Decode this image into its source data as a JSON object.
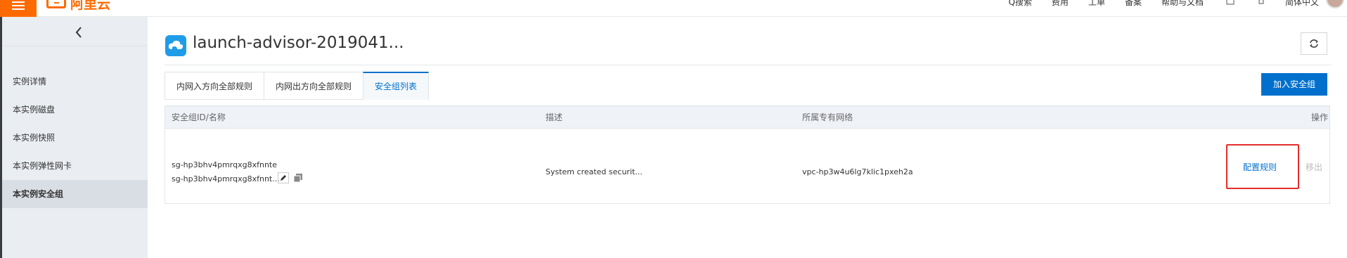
{
  "topbar": {
    "brand": "阿里云",
    "nav": [
      "Q搜索",
      "费用",
      "工单",
      "备案",
      "帮助与文档"
    ],
    "language": "简体中文"
  },
  "sidebar": {
    "items": [
      {
        "label": "实例详情",
        "active": false
      },
      {
        "label": "本实例磁盘",
        "active": false
      },
      {
        "label": "本实例快照",
        "active": false
      },
      {
        "label": "本实例弹性网卡",
        "active": false
      },
      {
        "label": "本实例安全组",
        "active": true
      }
    ]
  },
  "page": {
    "title": "launch-advisor-2019041..."
  },
  "tabs": [
    {
      "label": "内网入方向全部规则",
      "active": false
    },
    {
      "label": "内网出方向全部规则",
      "active": false
    },
    {
      "label": "安全组列表",
      "active": true
    }
  ],
  "actions": {
    "add_label": "加入安全组"
  },
  "table": {
    "headers": {
      "id_name": "安全组ID/名称",
      "description": "描述",
      "vpc": "所属专有网络",
      "operation": "操作"
    },
    "rows": [
      {
        "id": "sg-hp3bhv4pmrqxg8xfnnte",
        "name": "sg-hp3bhv4pmrqxg8xfnnt...",
        "description": "System created securit...",
        "vpc": "vpc-hp3w4u6lg7klic1pxeh2a",
        "config_label": "配置规则",
        "remove_label": "移出"
      }
    ]
  },
  "colors": {
    "brand": "#ff6a00",
    "primary": "#0070cc",
    "highlight_border": "#e32d2d"
  }
}
